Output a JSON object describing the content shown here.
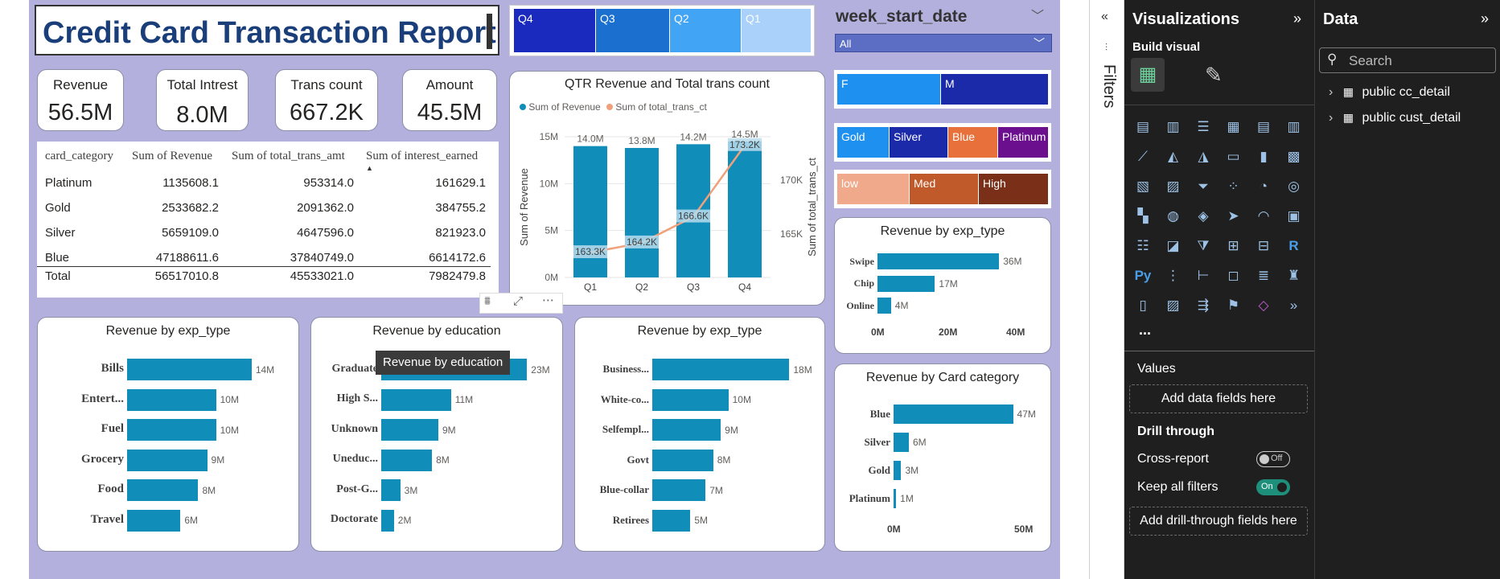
{
  "report": {
    "title": "Credit Card Transaction Report",
    "kpis": [
      {
        "label": "Revenue",
        "value": "56.5M"
      },
      {
        "label": "Total Intrest",
        "value": "8.0M"
      },
      {
        "label": "Trans count",
        "value": "667.2K"
      },
      {
        "label": "Amount",
        "value": "45.5M"
      }
    ],
    "quarter_slicer": [
      "Q4",
      "Q3",
      "Q2",
      "Q1"
    ],
    "week_slicer": {
      "title": "week_start_date",
      "value": "All"
    },
    "gender_slicer": [
      "F",
      "M"
    ],
    "card_slicer": [
      "Gold",
      "Silver",
      "Blue",
      "Platinum"
    ],
    "income_slicer": [
      "low",
      "Med",
      "High"
    ],
    "table": {
      "headers": [
        "card_category",
        "Sum of Revenue",
        "Sum of total_trans_amt",
        "Sum of interest_earned"
      ],
      "rows": [
        [
          "Platinum",
          "1135608.1",
          "953314.0",
          "161629.1"
        ],
        [
          "Gold",
          "2533682.2",
          "2091362.0",
          "384755.2"
        ],
        [
          "Silver",
          "5659109.0",
          "4647596.0",
          "821923.0"
        ],
        [
          "Blue",
          "47188611.6",
          "37840749.0",
          "6614172.6"
        ]
      ],
      "total": [
        "Total",
        "56517010.8",
        "45533021.0",
        "7982479.8"
      ]
    },
    "tooltip": "Revenue by education",
    "colors": {
      "canvas": "#b3b0dd",
      "bar": "#118dba",
      "line": "#f0a07a",
      "accent": "#1a2abf"
    }
  },
  "chart_data": [
    {
      "type": "bar",
      "title": "QTR Revenue and Total trans count",
      "categories": [
        "Q1",
        "Q2",
        "Q3",
        "Q4"
      ],
      "series": [
        {
          "name": "Sum of Revenue",
          "values": [
            14.0,
            13.8,
            14.2,
            14.5
          ],
          "labels": [
            "14.0M",
            "13.8M",
            "14.2M",
            "14.5M"
          ]
        },
        {
          "name": "Sum of total_trans_ct",
          "values": [
            163.3,
            164.2,
            166.6,
            173.2
          ],
          "labels": [
            "163.3K",
            "164.2K",
            "166.6K",
            "173.2K"
          ]
        }
      ],
      "ylabel": "Sum of Revenue",
      "y2label": "Sum of total_trans_ct",
      "yticks": [
        "15M",
        "10M",
        "5M",
        "0M"
      ],
      "y2ticks": [
        "170K",
        "165K"
      ],
      "ylim": [
        0,
        15
      ],
      "y2lim": [
        161,
        174
      ]
    },
    {
      "type": "bar",
      "title": "Revenue by exp_type",
      "categories": [
        "Bills",
        "Entert...",
        "Fuel",
        "Grocery",
        "Food",
        "Travel"
      ],
      "values": [
        14,
        10,
        10,
        9,
        8,
        6
      ],
      "labels": [
        "14M",
        "10M",
        "10M",
        "9M",
        "8M",
        "6M"
      ],
      "xlim": [
        0,
        16
      ]
    },
    {
      "type": "bar",
      "title": "Revenue by education",
      "categories": [
        "Graduate",
        "High S...",
        "Unknown",
        "Uneduc...",
        "Post-G...",
        "Doctorate"
      ],
      "values": [
        23,
        11,
        9,
        8,
        3,
        2
      ],
      "labels": [
        "23M",
        "11M",
        "9M",
        "8M",
        "3M",
        "2M"
      ],
      "xlim": [
        0,
        26
      ]
    },
    {
      "type": "bar",
      "title": "Revenue by exp_type",
      "categories": [
        "Business...",
        "White-co...",
        "Selfempl...",
        "Govt",
        "Blue-collar",
        "Retirees"
      ],
      "values": [
        18,
        10,
        9,
        8,
        7,
        5
      ],
      "labels": [
        "18M",
        "10M",
        "9M",
        "8M",
        "7M",
        "5M"
      ],
      "xlim": [
        0,
        20
      ]
    },
    {
      "type": "bar",
      "title": "Revenue by exp_type",
      "categories": [
        "Swipe",
        "Chip",
        "Online"
      ],
      "values": [
        36,
        17,
        4
      ],
      "labels": [
        "36M",
        "17M",
        "4M"
      ],
      "xticks": [
        "0M",
        "20M",
        "40M"
      ],
      "xlim": [
        0,
        44
      ]
    },
    {
      "type": "bar",
      "title": "Revenue by Card category",
      "categories": [
        "Blue",
        "Silver",
        "Gold",
        "Platinum"
      ],
      "values": [
        47,
        6,
        3,
        1
      ],
      "labels": [
        "47M",
        "6M",
        "3M",
        "1M"
      ],
      "xticks": [
        "0M",
        "50M"
      ],
      "xlim": [
        0,
        56
      ]
    }
  ],
  "panes": {
    "filters_label": "Filters",
    "viz": {
      "title": "Visualizations",
      "build_visual": "Build visual",
      "values_label": "Values",
      "values_well": "Add data fields here",
      "drill_through": "Drill through",
      "cross_report": "Cross-report",
      "cross_report_state": "Off",
      "keep_filters": "Keep all filters",
      "keep_filters_state": "On",
      "drill_well": "Add drill-through fields here",
      "more": "..."
    },
    "data": {
      "title": "Data",
      "search_placeholder": "Search",
      "tables": [
        "public cc_detail",
        "public cust_detail"
      ]
    }
  }
}
